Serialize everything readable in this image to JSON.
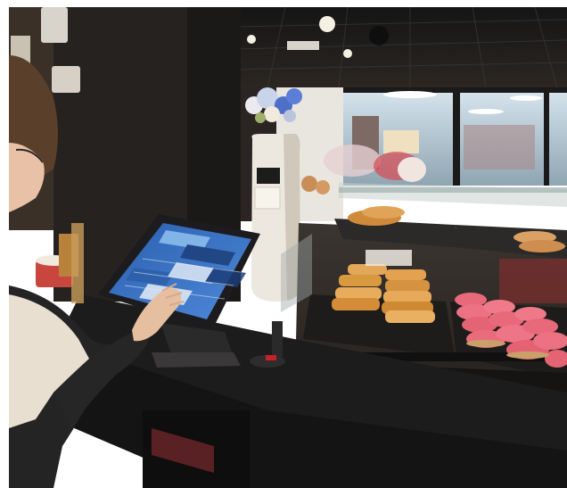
{
  "scene": {
    "description_free": true,
    "palette": {
      "ceiling": "#1a1a1a",
      "wall": "#2a2521",
      "counter": "#1b1b1b",
      "screen_glow": "#3b73c4",
      "eclair_glaze": "#e86a7a",
      "pastry": "#d99a4a",
      "vase": "#ece6dc",
      "sweater": "#242424"
    },
    "objects": [
      "pos-tablet",
      "pastry-display-case",
      "flower-vase",
      "cashier-hand",
      "card-reader"
    ]
  },
  "sign": {
    "vase_label": ""
  }
}
